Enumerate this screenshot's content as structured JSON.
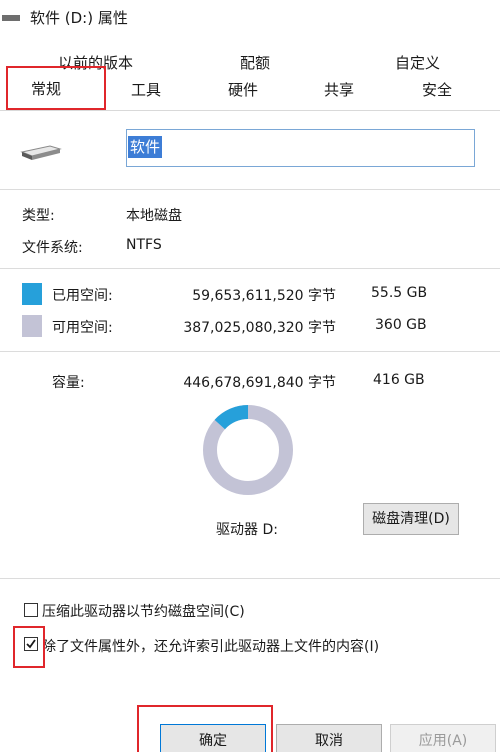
{
  "window": {
    "title": "软件 (D:) 属性"
  },
  "tabs_row1": [
    "以前的版本",
    "配额",
    "自定义"
  ],
  "tabs_row2": [
    "常规",
    "工具",
    "硬件",
    "共享",
    "安全"
  ],
  "drive": {
    "name": "软件"
  },
  "info": {
    "type_label": "类型:",
    "type_value": "本地磁盘",
    "fs_label": "文件系统:",
    "fs_value": "NTFS"
  },
  "space": {
    "used_label": "已用空间:",
    "used_bytes": "59,653,611,520 字节",
    "used_human": "55.5 GB",
    "free_label": "可用空间:",
    "free_bytes": "387,025,080,320 字节",
    "free_human": "360 GB",
    "cap_label": "容量:",
    "cap_bytes": "446,678,691,840 字节",
    "cap_human": "416 GB",
    "used_fraction": 0.133,
    "used_color": "#26a0da",
    "free_color": "#c3c3d6"
  },
  "drive_label": "驱动器 D:",
  "cleanup_button": "磁盘清理(D)",
  "options": {
    "compress_label": "压缩此驱动器以节约磁盘空间(C)",
    "compress_checked": false,
    "index_label": "除了文件属性外，还允许索引此驱动器上文件的内容(I)",
    "index_checked": true
  },
  "buttons": {
    "ok": "确定",
    "cancel": "取消",
    "apply": "应用(A)"
  }
}
